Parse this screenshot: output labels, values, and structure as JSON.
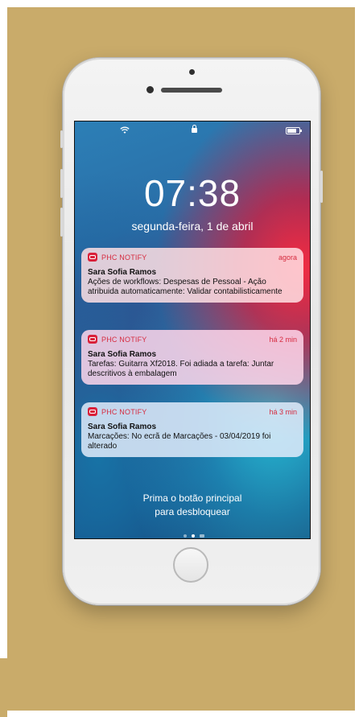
{
  "status_bar": {
    "wifi_icon": "wifi-icon",
    "lock_icon": "lock-icon",
    "battery_icon": "battery-icon"
  },
  "lockscreen": {
    "time": "07:38",
    "date": "segunda-feira, 1 de abril",
    "unlock_hint_line1": "Prima o botão principal",
    "unlock_hint_line2": "para desbloquear"
  },
  "notifications": [
    {
      "app": "PHC NOTIFY",
      "time": "agora",
      "title": "Sara Sofia Ramos",
      "body": "Ações de workflows: Despesas de Pessoal - Ação atribuida automaticamente: Validar contabilisticamente"
    },
    {
      "app": "PHC NOTIFY",
      "time": "há 2 min",
      "title": "Sara Sofia Ramos",
      "body": "Tarefas: Guitarra Xf2018. Foi adiada a tarefa: Juntar descritivos à embalagem"
    },
    {
      "app": "PHC NOTIFY",
      "time": "há 3 min",
      "title": "Sara Sofia Ramos",
      "body": "Marcações: No ecrã de Marcações - 03/04/2019 foi alterado"
    }
  ],
  "colors": {
    "background": "#c9ab6a",
    "accent": "#d62b3f"
  }
}
